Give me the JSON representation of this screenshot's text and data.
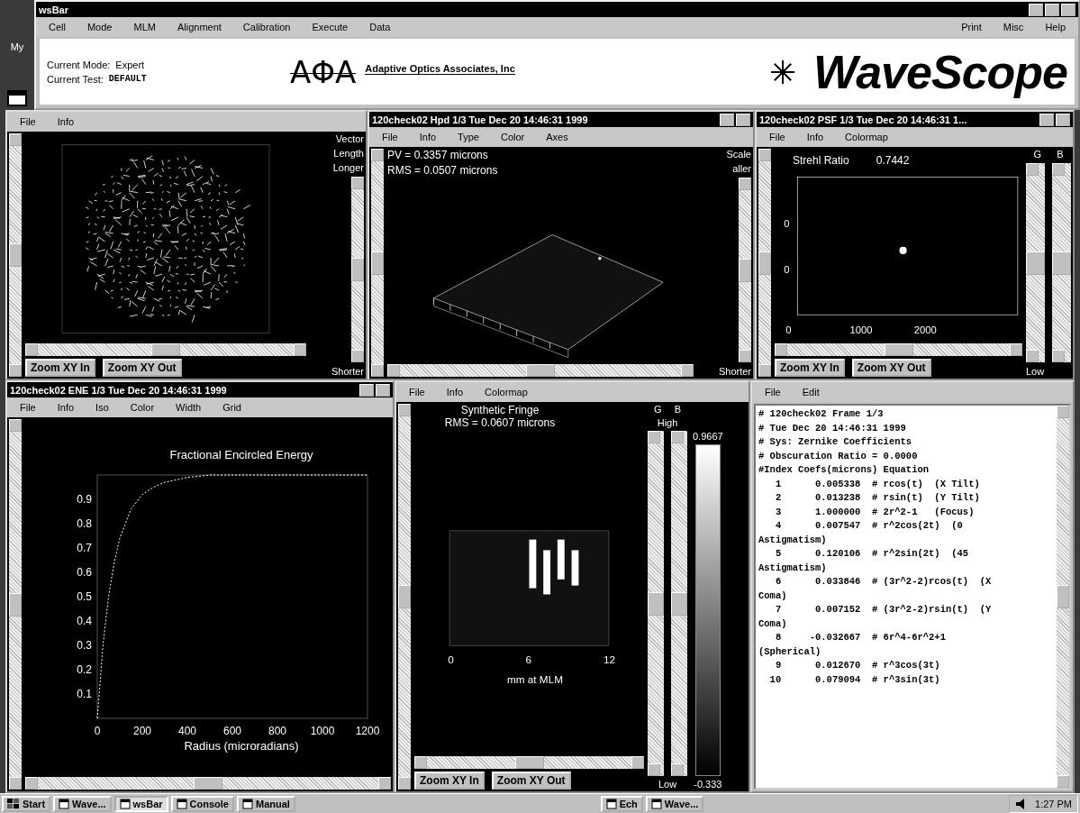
{
  "desktop": {
    "icon_label": "My"
  },
  "main_window": {
    "title": "wsBar",
    "menu": [
      "Cell",
      "Mode",
      "MLM",
      "Alignment",
      "Calibration",
      "Execute",
      "Data"
    ],
    "menu_right": [
      "Print",
      "Misc",
      "Help"
    ],
    "info": [
      {
        "label": "Current Mode:",
        "value": "Expert"
      },
      {
        "label": "Current Test:",
        "value": "DEFAULT"
      }
    ],
    "logo": {
      "mark": "AΦA",
      "company": "Adaptive Optics Associates, Inc",
      "product": "WaveScope"
    }
  },
  "panels": [
    {
      "kind": "vector",
      "menu": [
        "File",
        "Info"
      ],
      "labels": [
        "Vector",
        "Length"
      ],
      "top_label": "Longer",
      "bottom_label": "Shorter",
      "buttons": [
        "Zoom XY In",
        "Zoom XY Out"
      ]
    },
    {
      "kind": "surface",
      "title": "120check02 Hpd 1/3 Tue Dec 20 14:46:31 1999",
      "menu": [
        "File",
        "Info",
        "Type",
        "Color",
        "Axes"
      ],
      "readouts": [
        "PV = 0.3357 microns",
        "RMS = 0.0507 microns"
      ],
      "labels": [
        "Scale"
      ],
      "top_label": "aller",
      "bottom_label": "Shorter"
    },
    {
      "kind": "psf",
      "title": "120check02 PSF 1/3 Tue Dec 20 14:46:31 1...",
      "menu": [
        "File",
        "Info",
        "Colormap"
      ],
      "readout_label": "Strehl Ratio",
      "readout_value": "0.7442",
      "slider_labels": [
        "G",
        "B"
      ],
      "bottom_label": "Low",
      "y_ticks": [
        "0",
        "0"
      ],
      "x_ticks": [
        "0",
        "1000",
        "2000"
      ],
      "buttons": [
        "Zoom XY In",
        "Zoom XY Out"
      ]
    },
    {
      "kind": "chart",
      "title": "120check02 ENE 1/3 Tue Dec 20 14:46:31 1999",
      "menu": [
        "File",
        "Info",
        "Iso",
        "Color",
        "Width",
        "Grid"
      ],
      "chart_data": {
        "type": "line",
        "title": "Fractional Encircled Energy",
        "xlabel": "Radius (microradians)",
        "xlim": [
          0,
          1200
        ],
        "ylim": [
          0,
          1
        ],
        "xticks": [
          0,
          200,
          400,
          600,
          800,
          1000,
          1200
        ],
        "yticks": [
          0.1,
          0.2,
          0.3,
          0.4,
          0.5,
          0.6,
          0.7,
          0.8,
          0.9
        ],
        "x": [
          0,
          25,
          50,
          75,
          100,
          150,
          200,
          250,
          300,
          400,
          500,
          600,
          800,
          1000,
          1200
        ],
        "series": [
          {
            "color": "#ffffff",
            "line_style": "dashed",
            "values": [
              0,
              0.3,
              0.5,
              0.64,
              0.74,
              0.86,
              0.92,
              0.95,
              0.97,
              0.99,
              1,
              1,
              1,
              1,
              1
            ]
          }
        ]
      }
    },
    {
      "kind": "fringe",
      "menu": [
        "File",
        "Info",
        "Colormap"
      ],
      "readouts": [
        "Synthetic Fringe",
        "RMS = 0.0607 microns"
      ],
      "slider_labels": [
        "G",
        "B"
      ],
      "top_label": "High",
      "bottom_label": "Low",
      "scale_max": "0.9667",
      "scale_min": "-0.333",
      "x_ticks": [
        "0",
        "6",
        "12"
      ],
      "xlabel": "mm at MLM",
      "buttons": [
        "Zoom XY In",
        "Zoom XY Out"
      ]
    },
    {
      "kind": "text",
      "menu": [
        "File",
        "Edit"
      ],
      "lines": [
        "# 120check02 Frame 1/3",
        "# Tue Dec 20 14:46:31 1999",
        "# Sys: Zernike Coefficients",
        "# Obscuration Ratio = 0.0000",
        "#Index Coefs(microns) Equation",
        "   1      0.005338  # rcos(t)  (X Tilt)",
        "   2      0.013238  # rsin(t)  (Y Tilt)",
        "   3      1.000000  # 2r^2-1   (Focus)",
        "   4      0.007547  # r^2cos(2t)  (0",
        "Astigmatism)",
        "   5      0.120106  # r^2sin(2t)  (45",
        "Astigmatism)",
        "   6      0.033846  # (3r^2-2)rcos(t)  (X",
        "Coma)",
        "   7      0.007152  # (3r^2-2)rsin(t)  (Y",
        "Coma)",
        "   8     -0.032667  # 6r^4-6r^2+1",
        "(Spherical)",
        "   9      0.012670  # r^3cos(3t)",
        "  10      0.079094  # r^3sin(3t)"
      ]
    }
  ],
  "taskbar": {
    "start": "Start",
    "buttons": [
      {
        "label": "Wave...",
        "selected": false
      },
      {
        "label": "wsBar",
        "selected": true
      },
      {
        "label": "Console",
        "selected": false
      },
      {
        "label": "Manual",
        "selected": false
      }
    ],
    "buttons_right": [
      {
        "label": "Ech",
        "selected": false
      },
      {
        "label": "Wave...",
        "selected": false
      }
    ],
    "clock": "1:27 PM"
  }
}
